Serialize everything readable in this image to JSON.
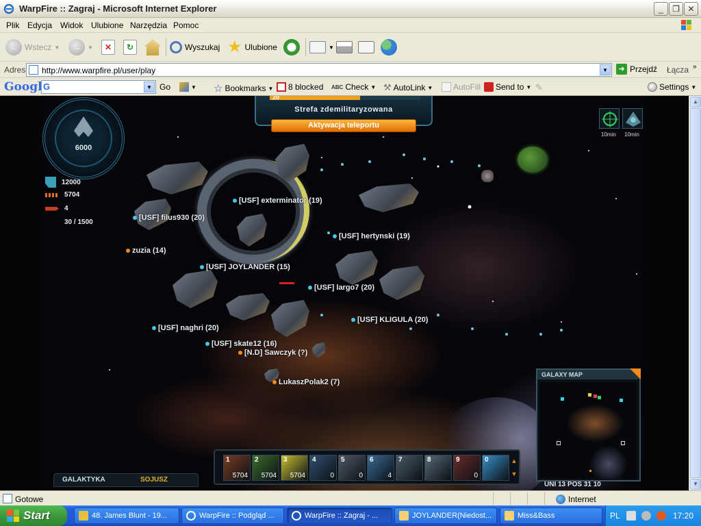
{
  "window": {
    "title": "WarpFire :: Zagraj - Microsoft Internet Explorer",
    "minimize_label": "_",
    "maximize_label": "❐",
    "close_label": "✕"
  },
  "menu": [
    "Plik",
    "Edycja",
    "Widok",
    "Ulubione",
    "Narzędzia",
    "Pomoc"
  ],
  "toolbar": {
    "back_label": "Wstecz",
    "search_label": "Wyszukaj",
    "favorites_label": "Ulubione"
  },
  "address": {
    "label": "Adres",
    "url": "http://www.warpfire.pl/user/play",
    "go_label": "Przejdź",
    "links_label": "Łącza"
  },
  "google_toolbar": {
    "logo": "Google",
    "go_label": "Go",
    "bookmarks_label": "Bookmarks",
    "blocked_label": "8 blocked",
    "check_label": "Check",
    "autolink_label": "AutoLink",
    "autofill_label": "AutoFill",
    "sendto_label": "Send to",
    "settings_label": "Settings"
  },
  "game": {
    "radar_value": "6000",
    "stats": [
      {
        "value": "12000",
        "icon": "shield-icon"
      },
      {
        "value": "5704",
        "icon": "ammo-icon"
      },
      {
        "value": "4",
        "icon": "rocket-icon"
      },
      {
        "value": "30 / 1500",
        "icon": ""
      }
    ],
    "zone_progress_label": "20",
    "zone_progress_fraction": 0.6,
    "zone_name": "Strefa zdemilitaryzowana",
    "teleport_label": "Aktywacja teleportu",
    "topright_labels": [
      "10min",
      "10min"
    ],
    "players": [
      {
        "name": "[USF] exterminator (19)",
        "color": "cyan"
      },
      {
        "name": "[USF] filus930 (20)",
        "color": "cyan"
      },
      {
        "name": "[USF] hertynski (19)",
        "color": "cyan"
      },
      {
        "name": "zuzia (14)",
        "color": "orange"
      },
      {
        "name": "[USF] JOYLANDER (15)",
        "color": "cyan"
      },
      {
        "name": "[USF] largo7 (20)",
        "color": "cyan"
      },
      {
        "name": "[USF] KLIGULA (20)",
        "color": "cyan"
      },
      {
        "name": "[USF] naghri (20)",
        "color": "cyan"
      },
      {
        "name": "[USF] skate12 (16)",
        "color": "cyan"
      },
      {
        "name": "[N.D] Sawczyk (?)",
        "color": "orange"
      },
      {
        "name": "LukaszPolak2 (7)",
        "color": "orange"
      }
    ],
    "galaxy_map": {
      "title": "GALAXY MAP",
      "position": "UNI 13 POS 31 10"
    },
    "hotbar": [
      {
        "slot": "1",
        "count": "5704",
        "color": "#7a3c22"
      },
      {
        "slot": "2",
        "count": "5704",
        "color": "#3b6b2a"
      },
      {
        "slot": "3",
        "count": "5704",
        "color": "#c9c032"
      },
      {
        "slot": "4",
        "count": "0",
        "color": "#2f4f6e"
      },
      {
        "slot": "5",
        "count": "0",
        "color": "#505a66"
      },
      {
        "slot": "6",
        "count": "4",
        "color": "#3a6a94"
      },
      {
        "slot": "7",
        "count": "",
        "color": "#4a5a68"
      },
      {
        "slot": "8",
        "count": "",
        "color": "#5a6876"
      },
      {
        "slot": "9",
        "count": "0",
        "color": "#6a2a2a"
      },
      {
        "slot": "0",
        "count": "",
        "color": "#3a90c8"
      }
    ],
    "chat_tabs": [
      "GALAKTYKA",
      "SOJUSZ"
    ]
  },
  "status": {
    "text": "Gotowe",
    "zone": "Internet"
  },
  "taskbar": {
    "start_label": "Start",
    "tasks": [
      {
        "label": "48. James Blunt - 19...",
        "active": false
      },
      {
        "label": "WarpFire :: Podgląd ...",
        "active": false
      },
      {
        "label": "WarpFire :: Zagraj - ...",
        "active": true
      },
      {
        "label": "JOYLANDER(Niedost...",
        "active": false
      },
      {
        "label": "Miss&Bass",
        "active": false
      }
    ],
    "lang": "PL",
    "clock": "17:20"
  }
}
